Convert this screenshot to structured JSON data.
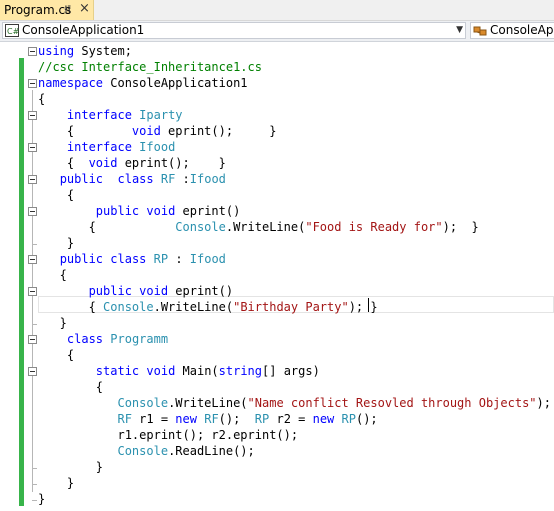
{
  "tab": {
    "label": "Program.cs",
    "pin_icon": "pin-icon",
    "close_icon": "close-icon"
  },
  "navbar": {
    "project_label": "ConsoleApplication1",
    "project_icon": "csharp-project-icon",
    "member_label": "ConsoleApp",
    "member_icon": "class-icon"
  },
  "colors": {
    "keyword": "#0000ff",
    "type": "#2b91af",
    "string": "#a31515",
    "comment": "#008000",
    "change_bar": "#38b44a",
    "tab_active": "#ffe8a6"
  },
  "code": {
    "lines": [
      [
        [
          "using",
          "kw"
        ],
        [
          " System;",
          ""
        ]
      ],
      [
        [
          "//csc Interface_Inheritance1.cs",
          "cm"
        ]
      ],
      [
        [
          "namespace",
          "kw"
        ],
        [
          " ConsoleApplication1",
          ""
        ]
      ],
      [
        [
          "{",
          ""
        ]
      ],
      [
        [
          "    ",
          ""
        ],
        [
          "interface",
          "kw"
        ],
        [
          " ",
          ""
        ],
        [
          "Iparty",
          "ty"
        ]
      ],
      [
        [
          "    {        ",
          ""
        ],
        [
          "void",
          "kw"
        ],
        [
          " eprint();     }",
          ""
        ]
      ],
      [
        [
          "    ",
          ""
        ],
        [
          "interface",
          "kw"
        ],
        [
          " ",
          ""
        ],
        [
          "Ifood",
          "ty"
        ]
      ],
      [
        [
          "    {  ",
          ""
        ],
        [
          "void",
          "kw"
        ],
        [
          " eprint();    }",
          ""
        ]
      ],
      [
        [
          "   ",
          ""
        ],
        [
          "public",
          "kw"
        ],
        [
          "  ",
          ""
        ],
        [
          "class",
          "kw"
        ],
        [
          " ",
          ""
        ],
        [
          "RF",
          "ty"
        ],
        [
          " :",
          ""
        ],
        [
          "Ifood",
          "ty"
        ]
      ],
      [
        [
          "    {",
          ""
        ]
      ],
      [
        [
          "        ",
          ""
        ],
        [
          "public",
          "kw"
        ],
        [
          " ",
          ""
        ],
        [
          "void",
          "kw"
        ],
        [
          " eprint()",
          ""
        ]
      ],
      [
        [
          "       {           ",
          ""
        ],
        [
          "Console",
          "ty"
        ],
        [
          ".WriteLine(",
          ""
        ],
        [
          "\"Food is Ready for\"",
          "st"
        ],
        [
          ");  }",
          ""
        ]
      ],
      [
        [
          "    }",
          ""
        ]
      ],
      [
        [
          "   ",
          ""
        ],
        [
          "public",
          "kw"
        ],
        [
          " ",
          ""
        ],
        [
          "class",
          "kw"
        ],
        [
          " ",
          ""
        ],
        [
          "RP",
          "ty"
        ],
        [
          " : ",
          ""
        ],
        [
          "Ifood",
          "ty"
        ]
      ],
      [
        [
          "   {",
          ""
        ]
      ],
      [
        [
          "       ",
          ""
        ],
        [
          "public",
          "kw"
        ],
        [
          " ",
          ""
        ],
        [
          "void",
          "kw"
        ],
        [
          " eprint()",
          ""
        ]
      ],
      [
        [
          "       { ",
          ""
        ],
        [
          "Console",
          "ty"
        ],
        [
          ".WriteLine(",
          ""
        ],
        [
          "\"Birthday Party\"",
          "st"
        ],
        [
          "); }",
          ""
        ]
      ],
      [
        [
          "   }",
          ""
        ]
      ],
      [
        [
          "    ",
          ""
        ],
        [
          "class",
          "kw"
        ],
        [
          " ",
          ""
        ],
        [
          "Programm",
          "ty"
        ]
      ],
      [
        [
          "    {",
          ""
        ]
      ],
      [
        [
          "        ",
          ""
        ],
        [
          "static",
          "kw"
        ],
        [
          " ",
          ""
        ],
        [
          "void",
          "kw"
        ],
        [
          " Main(",
          ""
        ],
        [
          "string",
          "kw"
        ],
        [
          "[] args)",
          ""
        ]
      ],
      [
        [
          "        {",
          ""
        ]
      ],
      [
        [
          "           ",
          ""
        ],
        [
          "Console",
          "ty"
        ],
        [
          ".WriteLine(",
          ""
        ],
        [
          "\"Name conflict Resovled through Objects\"",
          "st"
        ],
        [
          ");",
          ""
        ]
      ],
      [
        [
          "           ",
          ""
        ],
        [
          "RF",
          "ty"
        ],
        [
          " r1 = ",
          ""
        ],
        [
          "new",
          "kw"
        ],
        [
          " ",
          ""
        ],
        [
          "RF",
          "ty"
        ],
        [
          "();  ",
          ""
        ],
        [
          "RP",
          "ty"
        ],
        [
          " r2 = ",
          ""
        ],
        [
          "new",
          "kw"
        ],
        [
          " ",
          ""
        ],
        [
          "RP",
          "ty"
        ],
        [
          "();",
          ""
        ]
      ],
      [
        [
          "           r1.eprint(); r2.eprint();",
          ""
        ]
      ],
      [
        [
          "           ",
          ""
        ],
        [
          "Console",
          "ty"
        ],
        [
          ".ReadLine();",
          ""
        ]
      ],
      [
        [
          "        }",
          ""
        ]
      ],
      [
        [
          "    }",
          ""
        ]
      ],
      [
        [
          "}",
          ""
        ]
      ]
    ]
  }
}
